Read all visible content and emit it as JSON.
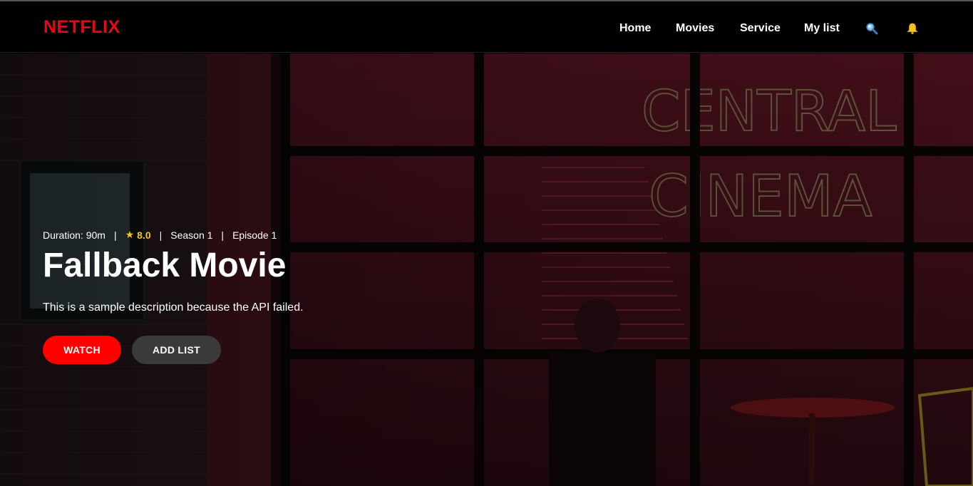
{
  "brand": {
    "logo": "NETFLIX",
    "color": "#e50914"
  },
  "nav": {
    "links": [
      {
        "label": "Home"
      },
      {
        "label": "Movies"
      },
      {
        "label": "Service"
      },
      {
        "label": "My list"
      }
    ],
    "icons": [
      "search-icon",
      "bell-icon"
    ]
  },
  "hero": {
    "duration": "Duration: 90m",
    "sep": "|",
    "rating_star": "★",
    "rating": "8.0",
    "season": "Season 1",
    "episode": "Episode 1",
    "title": "Fallback Movie",
    "description": "This is a sample description because the API failed.",
    "watch_label": "WATCH",
    "add_list_label": "ADD LIST",
    "rating_color": "#f5c518",
    "watch_color": "#ff0000"
  }
}
